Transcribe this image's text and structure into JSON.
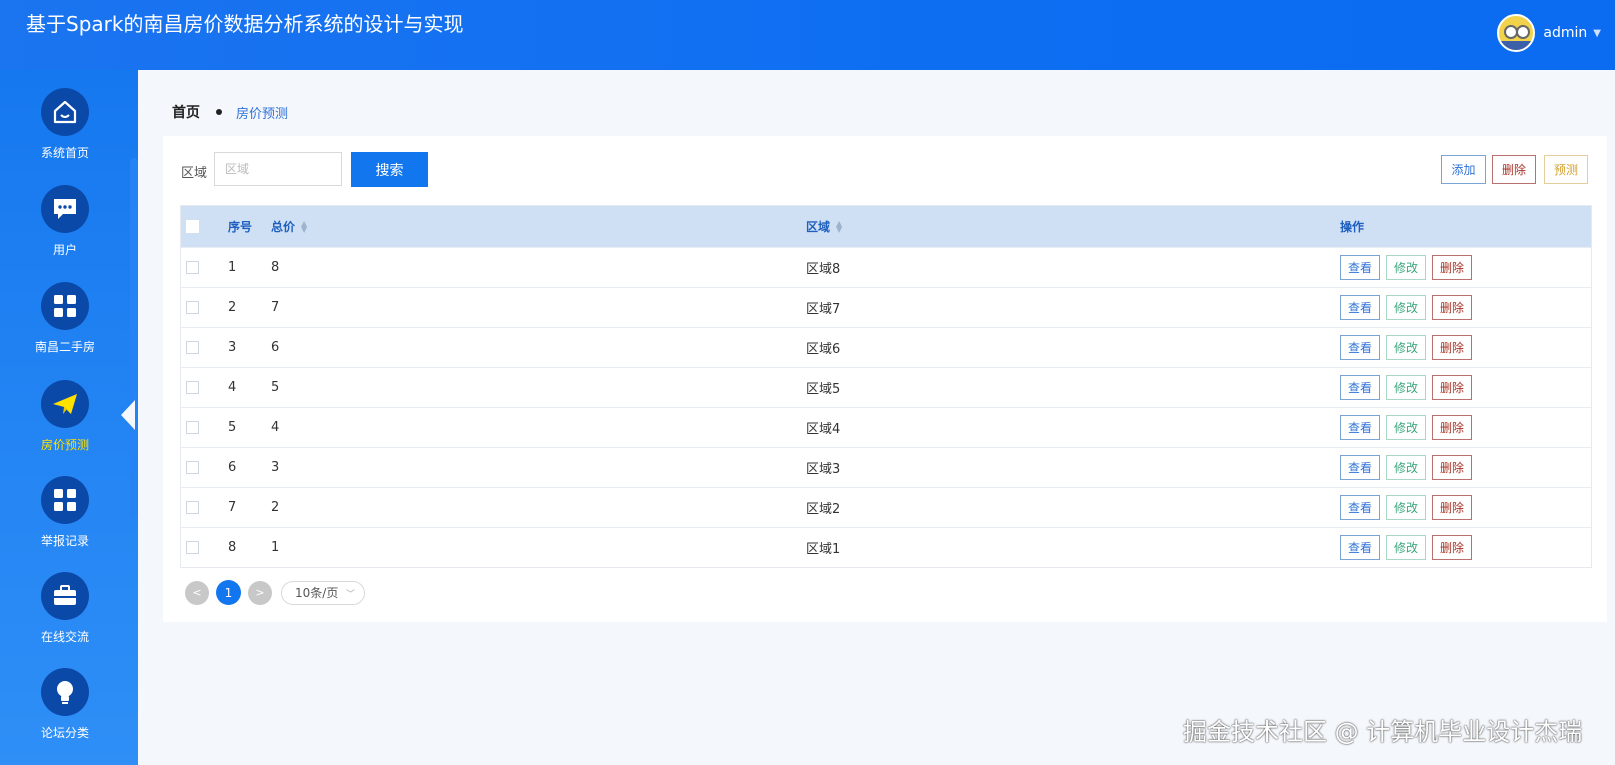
{
  "app": {
    "title": "基于Spark的南昌房价数据分析系统的设计与实现"
  },
  "user": {
    "name": "admin"
  },
  "sidebar": {
    "items": [
      {
        "label": "系统首页",
        "icon": "home-icon"
      },
      {
        "label": "用户",
        "icon": "chat-icon"
      },
      {
        "label": "南昌二手房",
        "icon": "grid-icon"
      },
      {
        "label": "房价预测",
        "icon": "paper-plane-icon",
        "active": true
      },
      {
        "label": "举报记录",
        "icon": "grid-icon"
      },
      {
        "label": "在线交流",
        "icon": "briefcase-icon"
      },
      {
        "label": "论坛分类",
        "icon": "lightbulb-icon"
      }
    ],
    "active_color": "#ffe100"
  },
  "breadcrumb": {
    "home": "首页",
    "current": "房价预测"
  },
  "search": {
    "label": "区域",
    "placeholder": "区域",
    "button": "搜索"
  },
  "toolbar": {
    "add": "添加",
    "delete": "删除",
    "predict": "预测"
  },
  "table": {
    "headers": {
      "no": "序号",
      "total": "总价",
      "area": "区域",
      "actions": "操作"
    },
    "rows": [
      {
        "no": "1",
        "total": "8",
        "area": "区域8"
      },
      {
        "no": "2",
        "total": "7",
        "area": "区域7"
      },
      {
        "no": "3",
        "total": "6",
        "area": "区域6"
      },
      {
        "no": "4",
        "total": "5",
        "area": "区域5"
      },
      {
        "no": "5",
        "total": "4",
        "area": "区域4"
      },
      {
        "no": "6",
        "total": "3",
        "area": "区域3"
      },
      {
        "no": "7",
        "total": "2",
        "area": "区域2"
      },
      {
        "no": "8",
        "total": "1",
        "area": "区域1"
      }
    ],
    "row_actions": {
      "view": "查看",
      "edit": "修改",
      "delete": "删除"
    }
  },
  "pagination": {
    "prev": "<",
    "current": "1",
    "next": ">",
    "page_size": "10条/页"
  },
  "watermark": "掘金技术社区 @ 计算机毕业设计杰瑞",
  "colors": {
    "header": "#0d6ef2",
    "primary": "#1277ee",
    "table_header": "#cfe0f5"
  }
}
